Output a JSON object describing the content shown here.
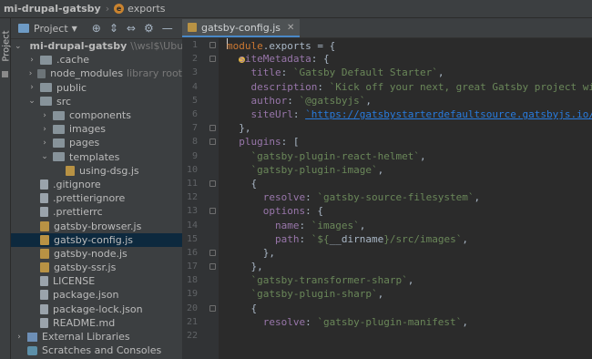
{
  "breadcrumb": {
    "project": "mi-drupal-gatsby",
    "item": "exports",
    "item_icon": "e"
  },
  "sidebar_strip": {
    "label": "Project"
  },
  "project_panel": {
    "title": "Project",
    "tree": [
      {
        "label": "mi-drupal-gatsby",
        "sub": "\\\\wsl$\\Ubuntu\\var\\w",
        "indent": 0,
        "arrow": "⌄",
        "icon": "folder",
        "bold": true
      },
      {
        "label": ".cache",
        "indent": 1,
        "arrow": "›",
        "icon": "folder"
      },
      {
        "label": "node_modules",
        "sub": "library root",
        "indent": 1,
        "arrow": "›",
        "icon": "folder-dark"
      },
      {
        "label": "public",
        "indent": 1,
        "arrow": "›",
        "icon": "folder"
      },
      {
        "label": "src",
        "indent": 1,
        "arrow": "⌄",
        "icon": "folder"
      },
      {
        "label": "components",
        "indent": 2,
        "arrow": "›",
        "icon": "folder"
      },
      {
        "label": "images",
        "indent": 2,
        "arrow": "›",
        "icon": "folder"
      },
      {
        "label": "pages",
        "indent": 2,
        "arrow": "›",
        "icon": "folder"
      },
      {
        "label": "templates",
        "indent": 2,
        "arrow": "⌄",
        "icon": "folder"
      },
      {
        "label": "using-dsg.js",
        "indent": 3,
        "arrow": "",
        "icon": "js"
      },
      {
        "label": ".gitignore",
        "indent": 1,
        "arrow": "",
        "icon": "txt"
      },
      {
        "label": ".prettierignore",
        "indent": 1,
        "arrow": "",
        "icon": "txt"
      },
      {
        "label": ".prettierrc",
        "indent": 1,
        "arrow": "",
        "icon": "txt"
      },
      {
        "label": "gatsby-browser.js",
        "indent": 1,
        "arrow": "",
        "icon": "js"
      },
      {
        "label": "gatsby-config.js",
        "indent": 1,
        "arrow": "",
        "icon": "js",
        "selected": true
      },
      {
        "label": "gatsby-node.js",
        "indent": 1,
        "arrow": "",
        "icon": "js"
      },
      {
        "label": "gatsby-ssr.js",
        "indent": 1,
        "arrow": "",
        "icon": "js"
      },
      {
        "label": "LICENSE",
        "indent": 1,
        "arrow": "",
        "icon": "txt"
      },
      {
        "label": "package.json",
        "indent": 1,
        "arrow": "",
        "icon": "txt"
      },
      {
        "label": "package-lock.json",
        "indent": 1,
        "arrow": "",
        "icon": "txt"
      },
      {
        "label": "README.md",
        "indent": 1,
        "arrow": "",
        "icon": "txt"
      },
      {
        "label": "External Libraries",
        "indent": 0,
        "arrow": "›",
        "icon": "lib"
      },
      {
        "label": "Scratches and Consoles",
        "indent": 0,
        "arrow": "",
        "icon": "scratch"
      }
    ]
  },
  "editor": {
    "tab": {
      "name": "gatsby-config.js"
    },
    "lines": [
      {
        "n": "1",
        "fold": true,
        "cursor": true,
        "segs": [
          [
            "k",
            "module"
          ],
          [
            "n",
            ".exports = {"
          ]
        ]
      },
      {
        "n": "2",
        "fold": true,
        "bulb": true,
        "segs": [
          [
            "n",
            "  "
          ],
          [
            "p",
            "siteMetadata"
          ],
          [
            "n",
            ": {"
          ]
        ]
      },
      {
        "n": "3",
        "segs": [
          [
            "n",
            "    "
          ],
          [
            "p",
            "title"
          ],
          [
            "n",
            ": "
          ],
          [
            "s",
            "`Gatsby Default Starter`"
          ],
          [
            "n",
            ","
          ]
        ]
      },
      {
        "n": "4",
        "segs": [
          [
            "n",
            "    "
          ],
          [
            "p",
            "description"
          ],
          [
            "n",
            ": "
          ],
          [
            "s",
            "`Kick off your next, great Gatsby project with thi"
          ]
        ]
      },
      {
        "n": "5",
        "segs": [
          [
            "n",
            "    "
          ],
          [
            "p",
            "author"
          ],
          [
            "n",
            ": "
          ],
          [
            "s",
            "`@gatsbyjs`"
          ],
          [
            "n",
            ","
          ]
        ]
      },
      {
        "n": "6",
        "segs": [
          [
            "n",
            "    "
          ],
          [
            "p",
            "siteUrl"
          ],
          [
            "n",
            ": "
          ],
          [
            "u",
            "`https://gatsbystarterdefaultsource.gatsbyjs.io/`"
          ],
          [
            "n",
            ","
          ]
        ]
      },
      {
        "n": "7",
        "fold": true,
        "segs": [
          [
            "n",
            "  },"
          ]
        ]
      },
      {
        "n": "8",
        "fold": true,
        "segs": [
          [
            "n",
            "  "
          ],
          [
            "p",
            "plugins"
          ],
          [
            "n",
            ": ["
          ]
        ]
      },
      {
        "n": "9",
        "segs": [
          [
            "n",
            "    "
          ],
          [
            "s",
            "`gatsby-plugin-react-helmet`"
          ],
          [
            "n",
            ","
          ]
        ]
      },
      {
        "n": "10",
        "segs": [
          [
            "n",
            "    "
          ],
          [
            "s",
            "`gatsby-plugin-image`"
          ],
          [
            "n",
            ","
          ]
        ]
      },
      {
        "n": "11",
        "fold": true,
        "segs": [
          [
            "n",
            "    {"
          ]
        ]
      },
      {
        "n": "12",
        "segs": [
          [
            "n",
            "      "
          ],
          [
            "p",
            "resolve"
          ],
          [
            "n",
            ": "
          ],
          [
            "s",
            "`gatsby-source-filesystem`"
          ],
          [
            "n",
            ","
          ]
        ]
      },
      {
        "n": "13",
        "fold": true,
        "segs": [
          [
            "n",
            "      "
          ],
          [
            "p",
            "options"
          ],
          [
            "n",
            ": {"
          ]
        ]
      },
      {
        "n": "14",
        "segs": [
          [
            "n",
            "        "
          ],
          [
            "p",
            "name"
          ],
          [
            "n",
            ": "
          ],
          [
            "s",
            "`images`"
          ],
          [
            "n",
            ","
          ]
        ]
      },
      {
        "n": "15",
        "segs": [
          [
            "n",
            "        "
          ],
          [
            "p",
            "path"
          ],
          [
            "n",
            ": "
          ],
          [
            "s",
            "`${"
          ],
          [
            "n",
            "__dirname"
          ],
          [
            "s",
            "}/src/images`"
          ],
          [
            "n",
            ","
          ]
        ]
      },
      {
        "n": "16",
        "fold": true,
        "segs": [
          [
            "n",
            "      },"
          ]
        ]
      },
      {
        "n": "17",
        "fold": true,
        "segs": [
          [
            "n",
            "    },"
          ]
        ]
      },
      {
        "n": "18",
        "segs": [
          [
            "n",
            "    "
          ],
          [
            "s",
            "`gatsby-transformer-sharp`"
          ],
          [
            "n",
            ","
          ]
        ]
      },
      {
        "n": "19",
        "segs": [
          [
            "n",
            "    "
          ],
          [
            "s",
            "`gatsby-plugin-sharp`"
          ],
          [
            "n",
            ","
          ]
        ]
      },
      {
        "n": "20",
        "fold": true,
        "segs": [
          [
            "n",
            "    {"
          ]
        ]
      },
      {
        "n": "21",
        "segs": [
          [
            "n",
            "      "
          ],
          [
            "p",
            "resolve"
          ],
          [
            "n",
            ": "
          ],
          [
            "s",
            "`gatsby-plugin-manifest`"
          ],
          [
            "n",
            ","
          ]
        ]
      },
      {
        "n": "22",
        "segs": [
          [
            "n",
            ""
          ]
        ]
      }
    ]
  }
}
